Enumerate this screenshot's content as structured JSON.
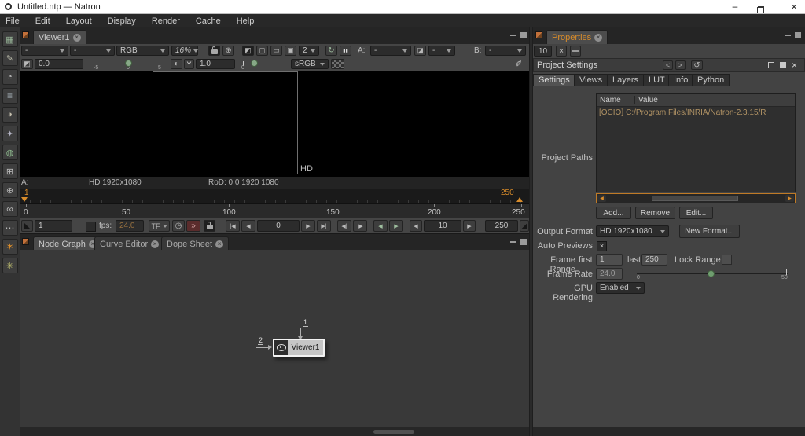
{
  "window": {
    "title": "Untitled.ntp — Natron"
  },
  "menu": {
    "items": [
      "File",
      "Edit",
      "Layout",
      "Display",
      "Render",
      "Cache",
      "Help"
    ]
  },
  "toolbox": {
    "icons": [
      {
        "name": "image-tool-icon",
        "glyph": "▦"
      },
      {
        "name": "draw-tool-icon",
        "glyph": "✎"
      },
      {
        "name": "time-tool-icon",
        "glyph": "◔"
      },
      {
        "name": "channel-tool-icon",
        "glyph": "≡"
      },
      {
        "name": "color-tool-icon",
        "glyph": "◑"
      },
      {
        "name": "filter-tool-icon",
        "glyph": "✦"
      },
      {
        "name": "merge-tool-icon",
        "glyph": "◍"
      },
      {
        "name": "transform-tool-icon",
        "glyph": "⊞"
      },
      {
        "name": "views-tool-icon",
        "glyph": "⊕"
      },
      {
        "name": "other-tool-icon",
        "glyph": "∞"
      },
      {
        "name": "more-tool-icon",
        "glyph": "⋯"
      },
      {
        "name": "keyer-tool-icon",
        "glyph": "✶"
      },
      {
        "name": "extra-tool-icon",
        "glyph": "✳"
      }
    ]
  },
  "viewer": {
    "tab_label": "Viewer1",
    "layer_value": "-",
    "alpha_value": "-",
    "channels_value": "RGB",
    "zoom_value": "16%",
    "sync_value": "2",
    "a_label": "A:",
    "a_value": "-",
    "wipe_op_value": "-",
    "b_label": "B:",
    "b_value": "-",
    "gain_value": "0.0",
    "gain_ticks": [
      "-5",
      "0",
      "5"
    ],
    "gamma_button": "Y",
    "gamma_value": "1.0",
    "gamma_tick": "0",
    "colorspace_value": "sRGB",
    "format_badge": "HD",
    "info_a_label": "A:",
    "info_format": "HD 1920x1080",
    "info_rod": "RoD: 0 0 1920 1080"
  },
  "timeline": {
    "current_frame": "1",
    "end_frame": "250",
    "ticks": [
      "0",
      "50",
      "100",
      "150",
      "200",
      "250"
    ]
  },
  "transport": {
    "in_point": "1",
    "fps_label": "fps:",
    "fps_value": "24.0",
    "timeformat_label": "TF",
    "current_frame": "0",
    "increment_value": "10",
    "out_point": "250"
  },
  "workspace": {
    "tabs": [
      "Node Graph",
      "Curve Editor",
      "Dope Sheet"
    ],
    "active_tab": "Node Graph"
  },
  "nodegraph": {
    "node_label": "Viewer1",
    "input1_label": "1",
    "input2_label": "2"
  },
  "properties": {
    "tab_label": "Properties",
    "max_panels_value": "10",
    "panel_title": "Project Settings",
    "tabs": [
      "Settings",
      "Views",
      "Layers",
      "LUT",
      "Info",
      "Python"
    ],
    "active_tab": "Settings",
    "project_paths_label": "Project Paths",
    "table_headers": [
      "Name",
      "Value"
    ],
    "row_name": "[OCIO]",
    "row_value": "C:/Program Files/INRIA/Natron-2.3.15/R",
    "add_button": "Add...",
    "remove_button": "Remove",
    "edit_button": "Edit...",
    "output_format_label": "Output Format",
    "output_format_value": "HD 1920x1080",
    "new_format_button": "New Format...",
    "auto_previews_label": "Auto Previews",
    "frame_range_label": "Frame Range",
    "first_label": "first",
    "first_value": "1",
    "last_label": "last",
    "last_value": "250",
    "lock_range_label": "Lock Range",
    "frame_rate_label": "Frame Rate",
    "frame_rate_value": "24.0",
    "rate_min": "0",
    "rate_max": "50",
    "gpu_label": "GPU Rendering",
    "gpu_value": "Enabled"
  },
  "glyphs": {
    "tab_close": "×",
    "win_min": "–",
    "win_close": "×",
    "check": "×",
    "center": "⊕",
    "clip": "◩",
    "roi": "▢",
    "format": "▭",
    "proxy": "▣",
    "refresh": "↻",
    "pause": "▮▮",
    "wipe": "◪",
    "gain": "◩",
    "contrast": "◐",
    "picker": "✐",
    "corner_in": "◣",
    "corner_out": "◢",
    "clock": "◷",
    "turbo": "»",
    "go_first": "|◀",
    "prev": "◀",
    "next": "▶",
    "go_last": "▶|",
    "prev_incr": "◀|",
    "next_incr": "|▶",
    "prev_key": "◀",
    "next_key": "▶",
    "left": "◀",
    "right": "▶",
    "back": "<",
    "fwd": ">",
    "undo_center": "↺"
  },
  "colors": {
    "accent_orange": "#d88c2b",
    "handle_green": "#87a887",
    "path_text": "#b09264",
    "titlebar": "#ffffff"
  }
}
